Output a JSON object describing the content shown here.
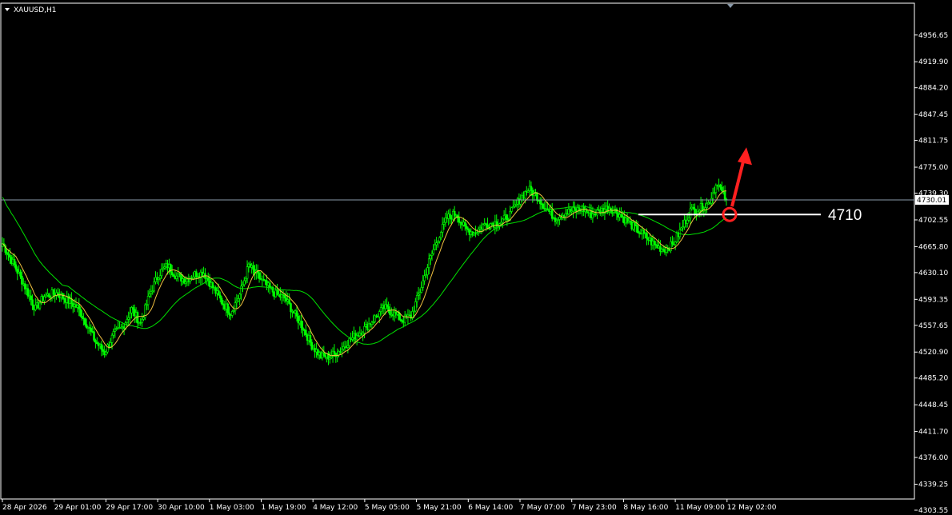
{
  "window": {
    "symbol_label": "XAUUSD,H1"
  },
  "chart_data": {
    "type": "candlestick",
    "title": "XAUUSD,H1",
    "ylim": [
      4303.55,
      4974.0
    ],
    "y_ticks": [
      "4956.65",
      "4919.90",
      "4884.20",
      "4847.45",
      "4811.75",
      "4775.00",
      "4739.30",
      "4702.55",
      "4665.80",
      "4630.10",
      "4593.35",
      "4557.65",
      "4520.90",
      "4485.20",
      "4448.45",
      "4411.70",
      "4376.00",
      "4339.25",
      "4303.55"
    ],
    "x_ticks": [
      "28 Apr 2026",
      "29 Apr 01:00",
      "29 Apr 17:00",
      "30 Apr 10:00",
      "1 May 03:00",
      "1 May 19:00",
      "4 May 12:00",
      "5 May 05:00",
      "5 May 21:00",
      "6 May 14:00",
      "7 May 07:00",
      "7 May 23:00",
      "8 May 16:00",
      "11 May 09:00",
      "12 May 02:00"
    ],
    "current_price_label": "4730.01",
    "current_price": 4730.01,
    "annotation": {
      "text": "4710",
      "level": 4710,
      "direction": "up"
    },
    "close_path": [
      [
        0,
        4670
      ],
      [
        3,
        4640
      ],
      [
        5,
        4615
      ],
      [
        8,
        4580
      ],
      [
        10,
        4598
      ],
      [
        13,
        4602
      ],
      [
        15,
        4594
      ],
      [
        18,
        4582
      ],
      [
        20,
        4560
      ],
      [
        22,
        4535
      ],
      [
        24,
        4520
      ],
      [
        26,
        4545
      ],
      [
        28,
        4555
      ],
      [
        30,
        4580
      ],
      [
        32,
        4560
      ],
      [
        34,
        4600
      ],
      [
        36,
        4628
      ],
      [
        38,
        4640
      ],
      [
        40,
        4625
      ],
      [
        42,
        4620
      ],
      [
        44,
        4628
      ],
      [
        46,
        4630
      ],
      [
        48,
        4610
      ],
      [
        50,
        4590
      ],
      [
        52,
        4575
      ],
      [
        54,
        4600
      ],
      [
        56,
        4640
      ],
      [
        58,
        4625
      ],
      [
        60,
        4612
      ],
      [
        62,
        4600
      ],
      [
        64,
        4595
      ],
      [
        66,
        4575
      ],
      [
        68,
        4555
      ],
      [
        70,
        4530
      ],
      [
        72,
        4515
      ],
      [
        74,
        4515
      ],
      [
        76,
        4522
      ],
      [
        78,
        4535
      ],
      [
        80,
        4545
      ],
      [
        82,
        4555
      ],
      [
        84,
        4568
      ],
      [
        86,
        4582
      ],
      [
        88,
        4575
      ],
      [
        90,
        4565
      ],
      [
        92,
        4570
      ],
      [
        94,
        4605
      ],
      [
        96,
        4645
      ],
      [
        98,
        4678
      ],
      [
        100,
        4705
      ],
      [
        102,
        4712
      ],
      [
        104,
        4690
      ],
      [
        106,
        4685
      ],
      [
        108,
        4695
      ],
      [
        110,
        4698
      ],
      [
        112,
        4700
      ],
      [
        114,
        4710
      ],
      [
        116,
        4730
      ],
      [
        118,
        4745
      ],
      [
        120,
        4735
      ],
      [
        122,
        4718
      ],
      [
        124,
        4705
      ],
      [
        126,
        4712
      ],
      [
        128,
        4715
      ],
      [
        130,
        4718
      ],
      [
        132,
        4710
      ],
      [
        134,
        4715
      ],
      [
        136,
        4720
      ],
      [
        138,
        4712
      ],
      [
        140,
        4700
      ],
      [
        142,
        4690
      ],
      [
        144,
        4680
      ],
      [
        146,
        4668
      ],
      [
        148,
        4662
      ],
      [
        150,
        4668
      ],
      [
        152,
        4690
      ],
      [
        154,
        4715
      ],
      [
        156,
        4718
      ],
      [
        158,
        4725
      ],
      [
        160,
        4755
      ],
      [
        161,
        4740
      ],
      [
        162,
        4730
      ]
    ],
    "overlays": [
      {
        "name": "fast-ma",
        "color": "#f0c040"
      },
      {
        "name": "slow-ma",
        "color": "#00e000"
      }
    ],
    "grid": false,
    "colors": {
      "candle": "#00ff00",
      "background": "#000000",
      "axis": "#ffffff",
      "price_line": "#8a9aaa",
      "annotation": "#ff2020"
    }
  }
}
